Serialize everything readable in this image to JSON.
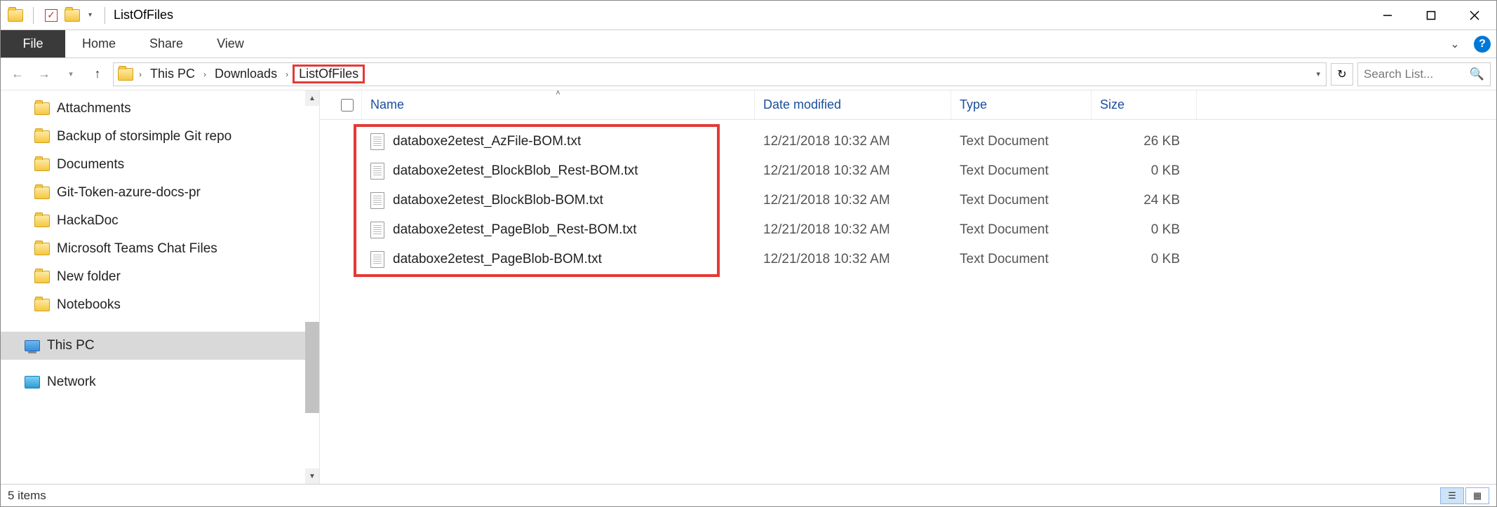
{
  "window": {
    "title": "ListOfFiles"
  },
  "ribbon": {
    "file": "File",
    "tabs": [
      "Home",
      "Share",
      "View"
    ]
  },
  "breadcrumb": {
    "root": "This PC",
    "mid": "Downloads",
    "current": "ListOfFiles"
  },
  "search": {
    "placeholder": "Search List..."
  },
  "sidebar": {
    "items": [
      "Attachments",
      "Backup of storsimple Git repo",
      "Documents",
      "Git-Token-azure-docs-pr",
      "HackaDoc",
      "Microsoft Teams Chat Files",
      "New folder",
      "Notebooks"
    ],
    "thispc": "This PC",
    "network": "Network"
  },
  "columns": {
    "name": "Name",
    "date": "Date modified",
    "type": "Type",
    "size": "Size"
  },
  "files": [
    {
      "name": "databoxe2etest_AzFile-BOM.txt",
      "date": "12/21/2018 10:32 AM",
      "type": "Text Document",
      "size": "26 KB"
    },
    {
      "name": "databoxe2etest_BlockBlob_Rest-BOM.txt",
      "date": "12/21/2018 10:32 AM",
      "type": "Text Document",
      "size": "0 KB"
    },
    {
      "name": "databoxe2etest_BlockBlob-BOM.txt",
      "date": "12/21/2018 10:32 AM",
      "type": "Text Document",
      "size": "24 KB"
    },
    {
      "name": "databoxe2etest_PageBlob_Rest-BOM.txt",
      "date": "12/21/2018 10:32 AM",
      "type": "Text Document",
      "size": "0 KB"
    },
    {
      "name": "databoxe2etest_PageBlob-BOM.txt",
      "date": "12/21/2018 10:32 AM",
      "type": "Text Document",
      "size": "0 KB"
    }
  ],
  "status": {
    "text": "5 items"
  }
}
